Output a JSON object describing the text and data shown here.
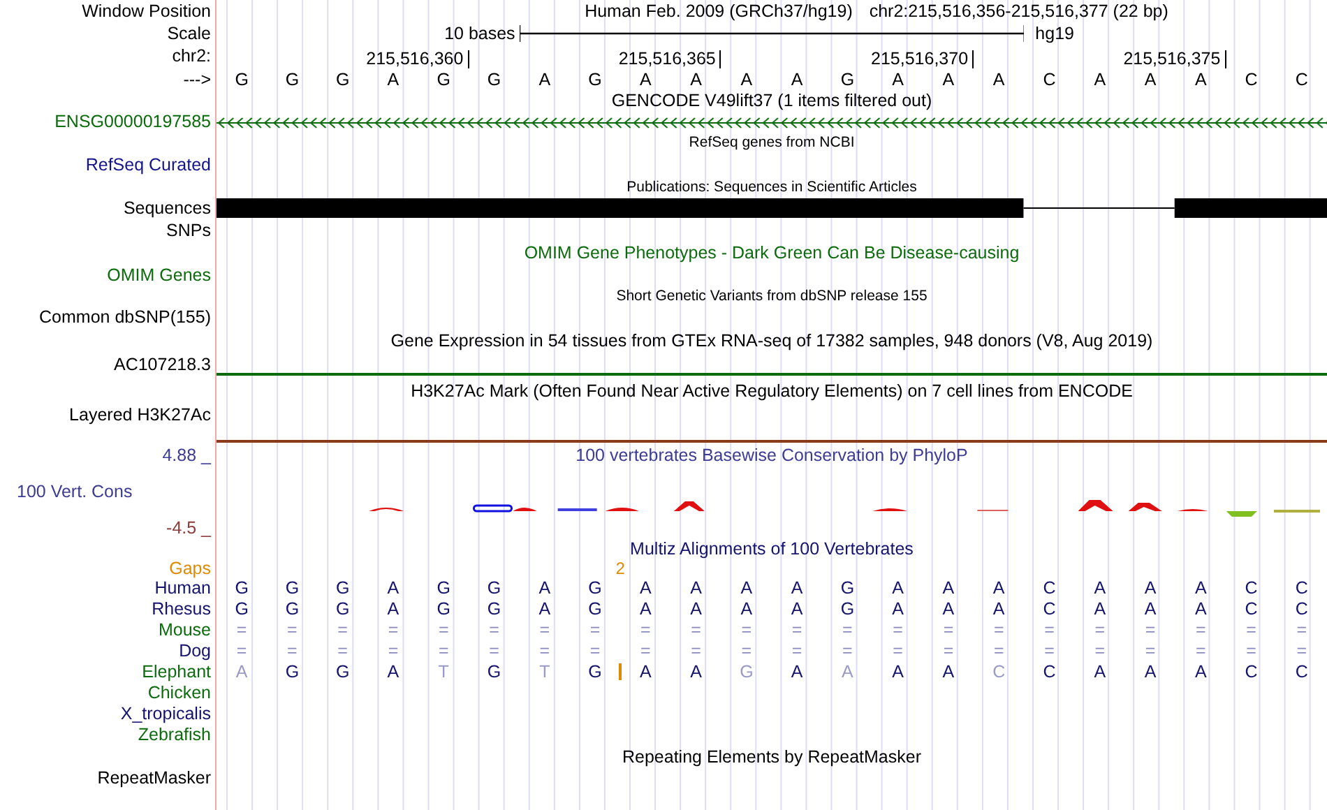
{
  "rows": [
    {
      "kind": "position",
      "label": "Window Position",
      "assembly": "Human Feb. 2009 (GRCh37/hg19)",
      "region": "chr2:215,516,356-215,516,377 (22 bp)"
    },
    {
      "kind": "scale",
      "label": "Scale",
      "text": "10 bases",
      "assembly": "hg19"
    },
    {
      "kind": "ruler",
      "label": "chr2:",
      "ticks": [
        "215,516,360",
        "215,516,365",
        "215,516,370",
        "215,516,375"
      ]
    },
    {
      "kind": "sequence",
      "label": "--->",
      "bases": [
        "G",
        "G",
        "G",
        "A",
        "G",
        "G",
        "A",
        "G",
        "A",
        "A",
        "A",
        "A",
        "G",
        "A",
        "A",
        "A",
        "C",
        "A",
        "A",
        "A",
        "C",
        "C"
      ]
    },
    {
      "kind": "title",
      "text": "GENCODE V49lift37 (1 items filtered out)",
      "small": false,
      "color": "#000000"
    },
    {
      "kind": "gene",
      "label": "ENSG00000197585",
      "color": "#0c6b0c"
    },
    {
      "kind": "title",
      "text": "RefSeq genes from NCBI",
      "small": true,
      "color": "#000000"
    },
    {
      "kind": "label",
      "label": "RefSeq Curated",
      "color": "#14148c"
    },
    {
      "kind": "title",
      "text": "Publications: Sequences in Scientific Articles",
      "small": true,
      "color": "#000000"
    },
    {
      "kind": "blocks",
      "label": "Sequences",
      "color": "#000000"
    },
    {
      "kind": "label",
      "label": "SNPs",
      "color": "#000000"
    },
    {
      "kind": "title",
      "text": "OMIM Gene Phenotypes - Dark Green Can Be Disease-causing",
      "small": false,
      "color": "#0c6b0c"
    },
    {
      "kind": "label",
      "label": "OMIM Genes",
      "color": "#0c6b0c"
    },
    {
      "kind": "title",
      "text": "Short Genetic Variants from dbSNP release 155",
      "small": true,
      "color": "#000000"
    },
    {
      "kind": "label",
      "label": "Common dbSNP(155)",
      "color": "#000000"
    },
    {
      "kind": "title",
      "text": "Gene Expression in 54 tissues from GTEx RNA-seq of 17382 samples, 948 donors (V8, Aug 2019)",
      "small": false,
      "color": "#000000"
    },
    {
      "kind": "signal",
      "label": "AC107218.3",
      "color": "#0c6b0c"
    },
    {
      "kind": "title",
      "text": "H3K27Ac Mark (Often Found Near Active Regulatory Elements) on 7 cell lines from ENCODE",
      "small": false,
      "color": "#000000"
    },
    {
      "kind": "signal",
      "label": "Layered H3K27Ac",
      "color": "#8b3a1a"
    },
    {
      "kind": "conservation",
      "label": "100 Vert. Cons",
      "max": "4.88 _",
      "min": "-4.5 _",
      "title": "100 vertebrates Basewise Conservation by PhyloP"
    },
    {
      "kind": "title",
      "text": "Multiz Alignments of 100 Vertebrates",
      "small": false,
      "color": "#14146e"
    },
    {
      "kind": "gaps",
      "label": "Gaps",
      "color": "#e08a00",
      "columns": [
        null,
        null,
        null,
        null,
        null,
        null,
        null,
        "2",
        null,
        null,
        null,
        null,
        null,
        null,
        null,
        null,
        null,
        null,
        null,
        null,
        null,
        null
      ]
    },
    {
      "kind": "species",
      "label": "Human",
      "color": "#14146e",
      "bases": [
        "G",
        "G",
        "G",
        "A",
        "G",
        "G",
        "A",
        "G",
        "A",
        "A",
        "A",
        "A",
        "G",
        "A",
        "A",
        "A",
        "C",
        "A",
        "A",
        "A",
        "C",
        "C"
      ]
    },
    {
      "kind": "species",
      "label": "Rhesus",
      "color": "#14146e",
      "bases": [
        "G",
        "G",
        "G",
        "A",
        "G",
        "G",
        "A",
        "G",
        "A",
        "A",
        "A",
        "A",
        "G",
        "A",
        "A",
        "A",
        "C",
        "A",
        "A",
        "A",
        "C",
        "C"
      ]
    },
    {
      "kind": "identical",
      "label": "Mouse",
      "color": "#0c6b0c",
      "bases": [
        "=",
        "=",
        "=",
        "=",
        "=",
        "=",
        "=",
        "=",
        "=",
        "=",
        "=",
        "=",
        "=",
        "=",
        "=",
        "=",
        "=",
        "=",
        "=",
        "=",
        "=",
        "="
      ]
    },
    {
      "kind": "identical",
      "label": "Dog",
      "color": "#14146e",
      "bases": [
        "=",
        "=",
        "=",
        "=",
        "=",
        "=",
        "=",
        "=",
        "=",
        "=",
        "=",
        "=",
        "=",
        "=",
        "=",
        "=",
        "=",
        "=",
        "=",
        "=",
        "=",
        "="
      ]
    },
    {
      "kind": "species",
      "label": "Elephant",
      "color": "#0c6b0c",
      "bases": [
        {
          "base": "A",
          "mismatch": true,
          "insertion": false
        },
        {
          "base": "G",
          "mismatch": false,
          "insertion": false
        },
        {
          "base": "G",
          "mismatch": false,
          "insertion": false
        },
        {
          "base": "A",
          "mismatch": false,
          "insertion": false
        },
        {
          "base": "T",
          "mismatch": true,
          "insertion": false
        },
        {
          "base": "G",
          "mismatch": false,
          "insertion": false
        },
        {
          "base": "T",
          "mismatch": true,
          "insertion": false
        },
        {
          "base": "G",
          "mismatch": false,
          "insertion": true
        },
        {
          "base": "A",
          "mismatch": false,
          "insertion": false
        },
        {
          "base": "A",
          "mismatch": false,
          "insertion": false
        },
        {
          "base": "G",
          "mismatch": true,
          "insertion": false
        },
        {
          "base": "A",
          "mismatch": false,
          "insertion": false
        },
        {
          "base": "A",
          "mismatch": true,
          "insertion": false
        },
        {
          "base": "A",
          "mismatch": false,
          "insertion": false
        },
        {
          "base": "A",
          "mismatch": false,
          "insertion": false
        },
        {
          "base": "C",
          "mismatch": true,
          "insertion": false
        },
        {
          "base": "C",
          "mismatch": false,
          "insertion": false
        },
        {
          "base": "A",
          "mismatch": false,
          "insertion": false
        },
        {
          "base": "A",
          "mismatch": false,
          "insertion": false
        },
        {
          "base": "A",
          "mismatch": false,
          "insertion": false
        },
        {
          "base": "C",
          "mismatch": false,
          "insertion": false
        },
        {
          "base": "C",
          "mismatch": false,
          "insertion": false
        }
      ]
    },
    {
      "kind": "species",
      "label": "Chicken",
      "color": "#0c6b0c"
    },
    {
      "kind": "species",
      "label": "X_tropicalis",
      "color": "#14146e"
    },
    {
      "kind": "species",
      "label": "Zebrafish",
      "color": "#0c6b0c"
    },
    {
      "kind": "title",
      "text": "Repeating Elements by RepeatMasker",
      "small": false,
      "color": "#000000"
    },
    {
      "kind": "label",
      "label": "RepeatMasker",
      "color": "#000000"
    }
  ]
}
